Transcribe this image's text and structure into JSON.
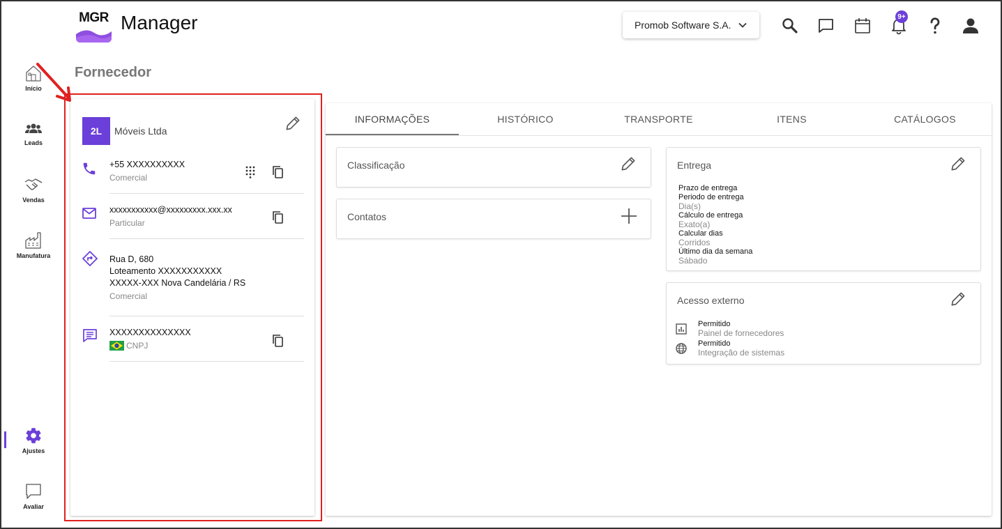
{
  "header": {
    "logo_text": "MGR",
    "app_title": "Manager",
    "company": "Promob Software S.A.",
    "notifications_badge": "9+"
  },
  "sidebar": {
    "items": [
      {
        "label": "Início",
        "icon": "home-icon"
      },
      {
        "label": "Leads",
        "icon": "people-icon"
      },
      {
        "label": "Vendas",
        "icon": "handshake-icon"
      },
      {
        "label": "Manufatura",
        "icon": "factory-icon"
      },
      {
        "label": "Ajustes",
        "icon": "gear-icon"
      },
      {
        "label": "Avaliar",
        "icon": "chat-icon"
      }
    ]
  },
  "page": {
    "title": "Fornecedor"
  },
  "supplier": {
    "avatar": "2L",
    "name": "Móveis Ltda",
    "phone": {
      "value": "+55 XXXXXXXXXX",
      "type": "Comercial"
    },
    "email": {
      "value": "xxxxxxxxxxx@xxxxxxxxx.xxx.xx",
      "type": "Particular"
    },
    "address": {
      "line1": "Rua D, 680",
      "line2": "Loteamento  XXXXXXXXXXX",
      "line3": "XXXXX-XXX  Nova Candelária / RS",
      "type": "Comercial"
    },
    "document": {
      "value": "XXXXXXXXXXXXXX",
      "type": "CNPJ"
    }
  },
  "tabs": [
    {
      "label": "INFORMAÇÕES"
    },
    {
      "label": "HISTÓRICO"
    },
    {
      "label": "TRANSPORTE"
    },
    {
      "label": "ITENS"
    },
    {
      "label": "CATÁLOGOS"
    }
  ],
  "classificacao": {
    "title": "Classificação"
  },
  "contatos": {
    "title": "Contatos"
  },
  "entrega": {
    "title": "Entrega",
    "rows": [
      {
        "label": "Prazo de entrega",
        "value": ""
      },
      {
        "label": "Periodo de entrega",
        "value": "Dia(s)"
      },
      {
        "label": "Cálculo de entrega",
        "value": "Exato(a)"
      },
      {
        "label": "Calcular dias",
        "value": "Corridos"
      },
      {
        "label": "Último dia da semana",
        "value": "Sábado"
      }
    ]
  },
  "acesso": {
    "title": "Acesso externo",
    "items": [
      {
        "label": "Permitido",
        "value": "Painel de fornecedores",
        "icon": "bar-chart-icon"
      },
      {
        "label": "Permitido",
        "value": "Integração de sistemas",
        "icon": "globe-icon"
      }
    ]
  },
  "colors": {
    "accent": "#6b3fd9",
    "highlight": "#e02020"
  }
}
